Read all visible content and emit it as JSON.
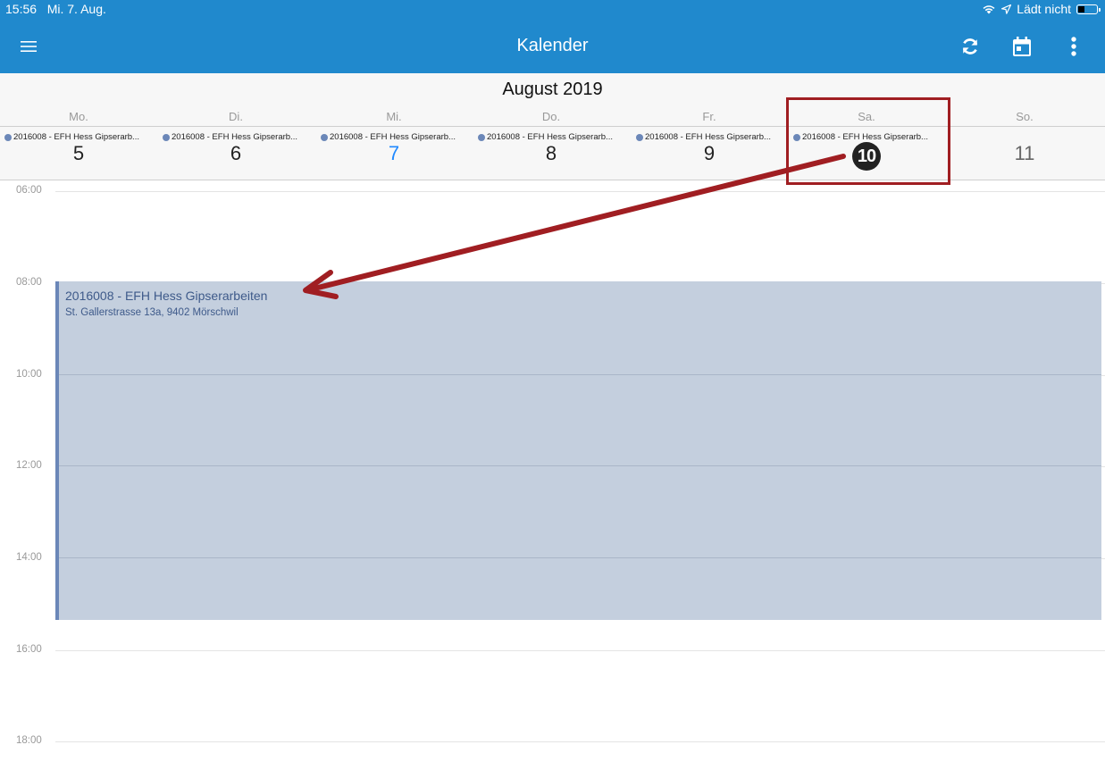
{
  "status": {
    "time": "15:56",
    "date": "Mi. 7. Aug.",
    "charging": "Lädt nicht"
  },
  "navbar": {
    "title": "Kalender",
    "menu_icon": "hamburger-icon",
    "refresh_icon": "refresh-icon",
    "calendar_icon": "calendar-icon",
    "more_icon": "more-vertical-icon"
  },
  "header": {
    "month": "August 2019",
    "days": [
      {
        "name": "Mo.",
        "number": "5",
        "event": "2016008 - EFH Hess Gipserarb..."
      },
      {
        "name": "Di.",
        "number": "6",
        "event": "2016008 - EFH Hess Gipserarb..."
      },
      {
        "name": "Mi.",
        "number": "7",
        "event": "2016008 - EFH Hess Gipserarb..."
      },
      {
        "name": "Do.",
        "number": "8",
        "event": "2016008 - EFH Hess Gipserarb..."
      },
      {
        "name": "Fr.",
        "number": "9",
        "event": "2016008 - EFH Hess Gipserarb..."
      },
      {
        "name": "Sa.",
        "number": "10",
        "event": "2016008 - EFH Hess Gipserarb..."
      },
      {
        "name": "So.",
        "number": "11",
        "event": ""
      }
    ]
  },
  "times": [
    "06:00",
    "08:00",
    "10:00",
    "12:00",
    "14:00",
    "16:00",
    "18:00"
  ],
  "event": {
    "title": "2016008 - EFH Hess Gipserarbeiten",
    "address": "St. Gallerstrasse 13a, 9402 Mörschwil"
  },
  "colors": {
    "accent": "#2089cd",
    "event_bg": "#c4cfde",
    "event_bar": "#6b87b8",
    "annotation": "#a01e22",
    "today": "#2089ff"
  }
}
